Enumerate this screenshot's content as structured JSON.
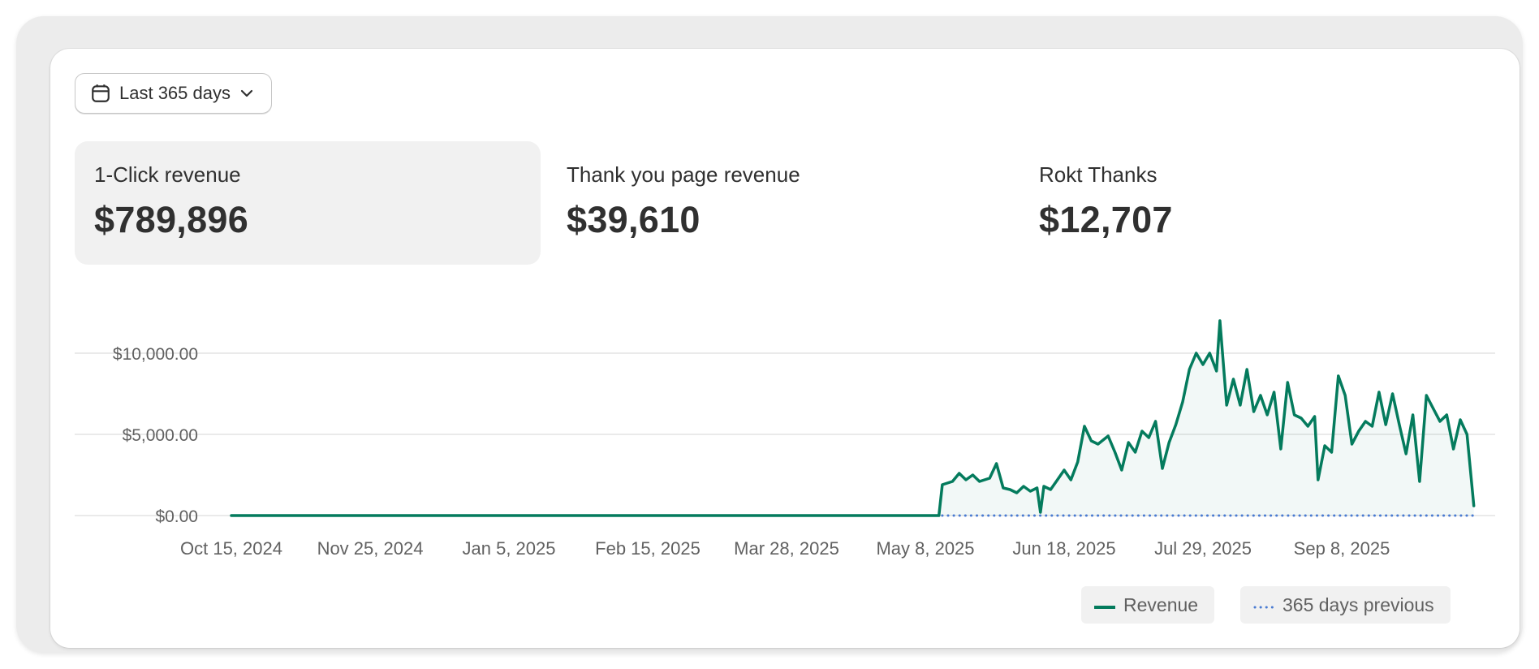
{
  "date_range": {
    "label": "Last 365 days"
  },
  "metrics": [
    {
      "label": "1-Click revenue",
      "value": "$789,896"
    },
    {
      "label": "Thank you page revenue",
      "value": "$39,610"
    },
    {
      "label": "Rokt Thanks",
      "value": "$12,707"
    }
  ],
  "legend": {
    "revenue": "Revenue",
    "previous": "365 days previous"
  },
  "colors": {
    "revenue": "#047b5d",
    "previous": "#4a7bd2",
    "selected_bg": "#f1f1f1"
  },
  "chart_data": {
    "type": "line",
    "x_ticks": [
      "Oct 15, 2024",
      "Nov 25, 2024",
      "Jan 5, 2025",
      "Feb 15, 2025",
      "Mar 28, 2025",
      "May 8, 2025",
      "Jun 18, 2025",
      "Jul 29, 2025",
      "Sep 8, 2025"
    ],
    "y_ticks": [
      "$0.00",
      "$5,000.00",
      "$10,000.00"
    ],
    "ylim": [
      0,
      12000
    ],
    "grid": true,
    "legend_position": "bottom-right",
    "series": [
      {
        "name": "Revenue",
        "style": "solid",
        "points": [
          [
            "Oct 15, 2024",
            0
          ],
          [
            "May 12, 2025",
            0
          ],
          [
            "May 13, 2025",
            1900
          ],
          [
            "May 16, 2025",
            2100
          ],
          [
            "May 18, 2025",
            2600
          ],
          [
            "May 20, 2025",
            2200
          ],
          [
            "May 22, 2025",
            2500
          ],
          [
            "May 24, 2025",
            2100
          ],
          [
            "May 27, 2025",
            2300
          ],
          [
            "May 29, 2025",
            3200
          ],
          [
            "May 31, 2025",
            1700
          ],
          [
            "Jun 2, 2025",
            1600
          ],
          [
            "Jun 4, 2025",
            1400
          ],
          [
            "Jun 6, 2025",
            1800
          ],
          [
            "Jun 8, 2025",
            1500
          ],
          [
            "Jun 10, 2025",
            1700
          ],
          [
            "Jun 11, 2025",
            200
          ],
          [
            "Jun 12, 2025",
            1800
          ],
          [
            "Jun 14, 2025",
            1600
          ],
          [
            "Jun 16, 2025",
            2200
          ],
          [
            "Jun 18, 2025",
            2800
          ],
          [
            "Jun 20, 2025",
            2200
          ],
          [
            "Jun 22, 2025",
            3300
          ],
          [
            "Jun 24, 2025",
            5500
          ],
          [
            "Jun 26, 2025",
            4600
          ],
          [
            "Jun 28, 2025",
            4400
          ],
          [
            "Jul 1, 2025",
            4900
          ],
          [
            "Jul 3, 2025",
            3900
          ],
          [
            "Jul 5, 2025",
            2800
          ],
          [
            "Jul 7, 2025",
            4500
          ],
          [
            "Jul 9, 2025",
            3900
          ],
          [
            "Jul 11, 2025",
            5200
          ],
          [
            "Jul 13, 2025",
            4800
          ],
          [
            "Jul 15, 2025",
            5800
          ],
          [
            "Jul 17, 2025",
            2900
          ],
          [
            "Jul 19, 2025",
            4500
          ],
          [
            "Jul 21, 2025",
            5600
          ],
          [
            "Jul 23, 2025",
            7000
          ],
          [
            "Jul 25, 2025",
            9000
          ],
          [
            "Jul 27, 2025",
            10000
          ],
          [
            "Jul 29, 2025",
            9300
          ],
          [
            "Jul 31, 2025",
            10000
          ],
          [
            "Aug 2, 2025",
            8900
          ],
          [
            "Aug 3, 2025",
            12000
          ],
          [
            "Aug 5, 2025",
            6800
          ],
          [
            "Aug 7, 2025",
            8400
          ],
          [
            "Aug 9, 2025",
            6800
          ],
          [
            "Aug 11, 2025",
            9000
          ],
          [
            "Aug 13, 2025",
            6400
          ],
          [
            "Aug 15, 2025",
            7400
          ],
          [
            "Aug 17, 2025",
            6200
          ],
          [
            "Aug 19, 2025",
            7600
          ],
          [
            "Aug 21, 2025",
            4100
          ],
          [
            "Aug 23, 2025",
            8200
          ],
          [
            "Aug 25, 2025",
            6200
          ],
          [
            "Aug 27, 2025",
            6000
          ],
          [
            "Aug 29, 2025",
            5500
          ],
          [
            "Aug 31, 2025",
            6100
          ],
          [
            "Sep 1, 2025",
            2200
          ],
          [
            "Sep 3, 2025",
            4300
          ],
          [
            "Sep 5, 2025",
            3900
          ],
          [
            "Sep 7, 2025",
            8600
          ],
          [
            "Sep 9, 2025",
            7400
          ],
          [
            "Sep 11, 2025",
            4400
          ],
          [
            "Sep 13, 2025",
            5200
          ],
          [
            "Sep 15, 2025",
            5800
          ],
          [
            "Sep 17, 2025",
            5500
          ],
          [
            "Sep 19, 2025",
            7600
          ],
          [
            "Sep 21, 2025",
            5600
          ],
          [
            "Sep 23, 2025",
            7500
          ],
          [
            "Sep 25, 2025",
            5600
          ],
          [
            "Sep 27, 2025",
            3800
          ],
          [
            "Sep 29, 2025",
            6200
          ],
          [
            "Oct 1, 2025",
            2100
          ],
          [
            "Oct 3, 2025",
            7400
          ],
          [
            "Oct 5, 2025",
            6600
          ],
          [
            "Oct 7, 2025",
            5800
          ],
          [
            "Oct 9, 2025",
            6200
          ],
          [
            "Oct 11, 2025",
            4100
          ],
          [
            "Oct 13, 2025",
            5900
          ],
          [
            "Oct 15, 2025",
            5000
          ],
          [
            "Oct 17, 2025",
            600
          ]
        ]
      },
      {
        "name": "365 days previous",
        "style": "dotted",
        "points": [
          [
            "May 13, 2025",
            0
          ],
          [
            "Oct 17, 2025",
            0
          ]
        ]
      }
    ]
  }
}
